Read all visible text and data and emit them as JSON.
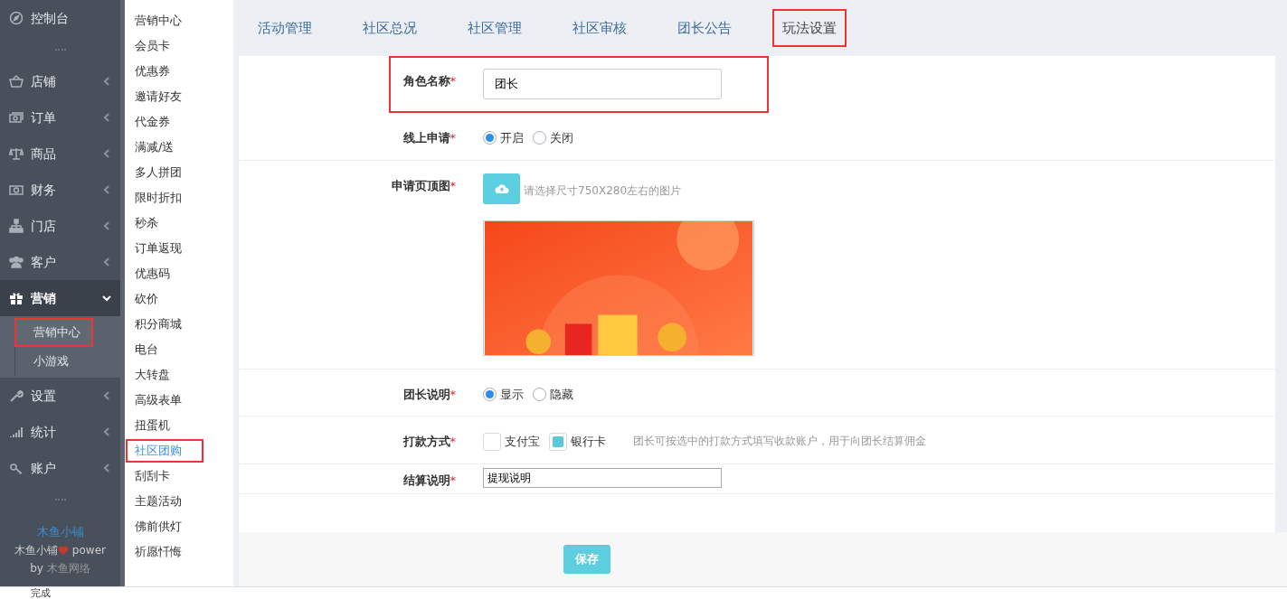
{
  "sidebar": {
    "items": [
      {
        "kind": "link",
        "label": "控制台"
      },
      {
        "kind": "separator"
      },
      {
        "kind": "group",
        "label": "店铺",
        "expanded": false
      },
      {
        "kind": "group",
        "label": "订单",
        "expanded": false
      },
      {
        "kind": "group",
        "label": "商品",
        "expanded": false
      },
      {
        "kind": "group",
        "label": "财务",
        "expanded": false
      },
      {
        "kind": "group",
        "label": "门店",
        "expanded": false
      },
      {
        "kind": "group",
        "label": "客户",
        "expanded": false
      },
      {
        "kind": "group",
        "label": "营销",
        "expanded": true,
        "children": [
          {
            "label": "营销中心",
            "selected": true
          },
          {
            "label": "小游戏",
            "selected": false
          }
        ]
      },
      {
        "kind": "group",
        "label": "设置",
        "expanded": false
      },
      {
        "kind": "group",
        "label": "统计",
        "expanded": false
      },
      {
        "kind": "group",
        "label": "账户",
        "expanded": false
      },
      {
        "kind": "separator"
      }
    ],
    "footer": {
      "brand": "木鱼小铺",
      "power_prefix": "木鱼小铺",
      "power_suffix": "power",
      "by_prefix": "by",
      "by_name": "木鱼网络"
    }
  },
  "submenu": [
    {
      "label": "营销中心",
      "selected": false
    },
    {
      "label": "会员卡",
      "selected": false
    },
    {
      "label": "优惠券",
      "selected": false
    },
    {
      "label": "邀请好友",
      "selected": false
    },
    {
      "label": "代金券",
      "selected": false
    },
    {
      "label": "满减/送",
      "selected": false
    },
    {
      "label": "多人拼团",
      "selected": false
    },
    {
      "label": "限时折扣",
      "selected": false
    },
    {
      "label": "秒杀",
      "selected": false
    },
    {
      "label": "订单返现",
      "selected": false
    },
    {
      "label": "优惠码",
      "selected": false
    },
    {
      "label": "砍价",
      "selected": false
    },
    {
      "label": "积分商城",
      "selected": false
    },
    {
      "label": "电台",
      "selected": false
    },
    {
      "label": "大转盘",
      "selected": false
    },
    {
      "label": "高级表单",
      "selected": false
    },
    {
      "label": "扭蛋机",
      "selected": false
    },
    {
      "label": "社区团购",
      "selected": true
    },
    {
      "label": "刮刮卡",
      "selected": false
    },
    {
      "label": "主题活动",
      "selected": false
    },
    {
      "label": "佛前供灯",
      "selected": false
    },
    {
      "label": "祈愿忏悔",
      "selected": false
    }
  ],
  "tabs": [
    {
      "label": "活动管理",
      "selected": false
    },
    {
      "label": "社区总况",
      "selected": false
    },
    {
      "label": "社区管理",
      "selected": false
    },
    {
      "label": "社区审核",
      "selected": false
    },
    {
      "label": "团长公告",
      "selected": false
    },
    {
      "label": "玩法设置",
      "selected": true
    }
  ],
  "form": [
    {
      "kind": "text",
      "label": "角色名称",
      "required_mark": "*",
      "value": "团长",
      "highlighted": true
    },
    {
      "kind": "radio",
      "label": "线上申请",
      "required_mark": "*",
      "options": [
        {
          "label": "开启",
          "selected": true
        },
        {
          "label": "关闭",
          "selected": false
        }
      ]
    },
    {
      "kind": "upload",
      "label": "申请页顶图",
      "required_mark": "*",
      "hint": "请选择尺寸750X280左右的图片"
    },
    {
      "kind": "radio",
      "label": "团长说明",
      "required_mark": "*",
      "options": [
        {
          "label": "显示",
          "selected": true
        },
        {
          "label": "隐藏",
          "selected": false
        }
      ]
    },
    {
      "kind": "checkbox",
      "label": "打款方式",
      "required_mark": "*",
      "options": [
        {
          "label": "支付宝",
          "checked": false
        },
        {
          "label": "银行卡",
          "checked": true
        }
      ],
      "hint": "团长可按选中的打款方式填写收款账户，用于向团长结算佣金"
    },
    {
      "kind": "textarea",
      "label": "结算说明",
      "required_mark": "*",
      "value": "提现说明"
    }
  ],
  "save_button": "保存",
  "status_bar": {
    "text": "完成"
  }
}
